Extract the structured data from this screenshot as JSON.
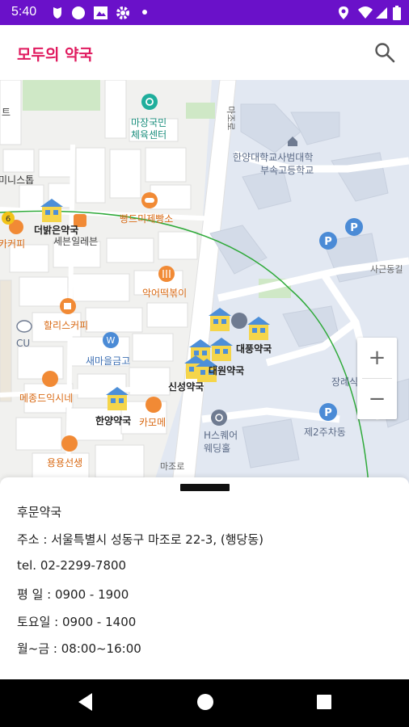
{
  "status_bar": {
    "time": "5:40",
    "bg_color": "#6a11c9",
    "icons": [
      "shield-icon",
      "circle-icon",
      "gallery-icon",
      "gear-icon",
      "dot-icon",
      "location-icon",
      "wifi-icon",
      "signal-icon",
      "battery-icon"
    ]
  },
  "app_bar": {
    "title": "모두의 약국",
    "title_color": "#e0195e",
    "search_icon": "search-icon"
  },
  "map": {
    "poi_labels": [
      "마장국민",
      "체육센터",
      "한양대학교사범대학",
      "부속고등학교",
      "미니스톱",
      "더밝은약국",
      "세븐일레븐",
      "빵드미제빵소",
      "카커피",
      "악어떡볶이",
      "할리스커피",
      "CU",
      "새마을금고",
      "메종드익시네",
      "한양약국",
      "카모메",
      "용용선생",
      "대풍약국",
      "대원약국",
      "신성약국",
      "H스퀘어",
      "웨딩홀",
      "제2주차동",
      "장례식",
      "사근동길",
      "마조로",
      "마조로",
      "트",
      "6"
    ],
    "route_color": "#2faa3a"
  },
  "zoom": {
    "in_label": "+",
    "out_label": "−"
  },
  "details": {
    "name": "후문약국",
    "address": "주소 : 서울특별시 성동구 마조로 22-3, (행당동)",
    "tel": "tel. 02-2299-7800",
    "weekday": "평  일 : 0900 - 1900",
    "saturday": "토요일 : 0900 - 1400",
    "mon_fri": "월~금 : 08:00~16:00"
  },
  "nav_bar": {
    "icons": [
      "back-icon",
      "home-icon",
      "recents-icon"
    ]
  }
}
